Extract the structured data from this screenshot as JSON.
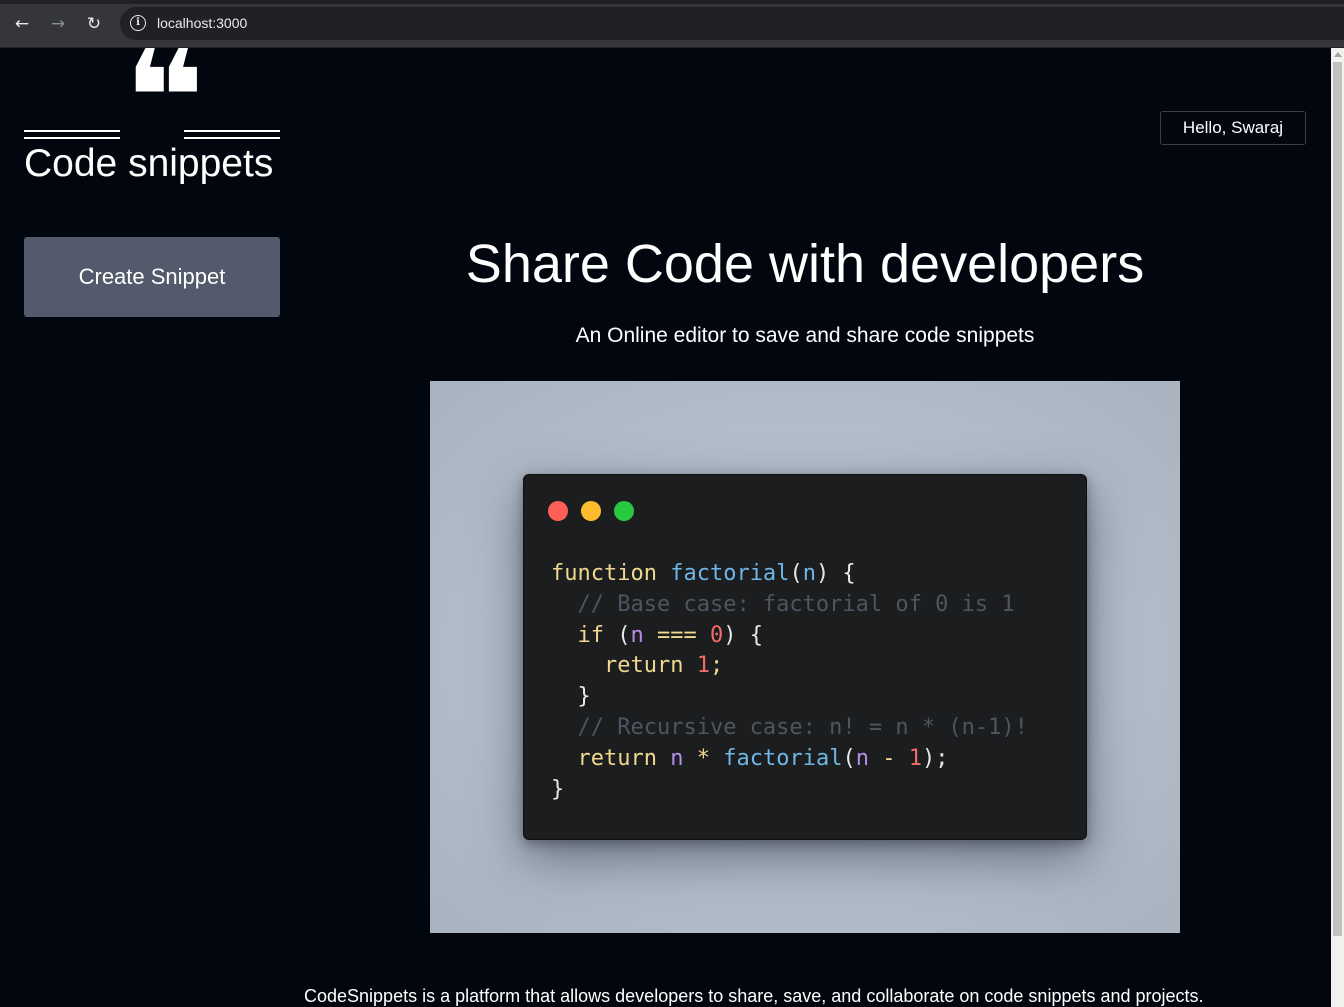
{
  "browser": {
    "url": "localhost:3000",
    "back_icon": "←",
    "forward_icon": "→",
    "reload_icon": "↻",
    "info_icon": "i"
  },
  "header": {
    "logo_glyph": "❝",
    "logo_text": "Code snippets",
    "greeting": "Hello, Swaraj"
  },
  "sidebar": {
    "create_button_label": "Create Snippet"
  },
  "hero": {
    "title": "Share Code with developers",
    "subtitle": "An Online editor to save and share code snippets"
  },
  "code_sample": {
    "line_1": {
      "kw": "function",
      "fn": "factorial",
      "open": "(",
      "var": "n",
      "close": ") {"
    },
    "line_2": "// Base case: factorial of 0 is 1",
    "line_3": {
      "kw": "if",
      "open": "(",
      "var": "n",
      "op": "===",
      "num": "0",
      "close": ") {"
    },
    "line_4": {
      "kw": "return",
      "num": "1",
      "end": ";"
    },
    "line_5": "}",
    "line_6": "// Recursive case: n! = n * (n-1)!",
    "line_7": {
      "kw": "return",
      "var1": "n",
      "op": "*",
      "fn": "factorial",
      "open": "(",
      "var2": "n",
      "minus": "-",
      "num": "1",
      "close": ");"
    },
    "line_8": "}"
  },
  "footer": {
    "description": "CodeSnippets is a platform that allows developers to share, save, and collaborate on code snippets and projects."
  },
  "colors": {
    "page_bg": "#02060f",
    "button_bg": "#525a6b",
    "traffic_red": "#fe5f57",
    "traffic_yellow": "#febc2e",
    "traffic_green": "#28c840"
  }
}
